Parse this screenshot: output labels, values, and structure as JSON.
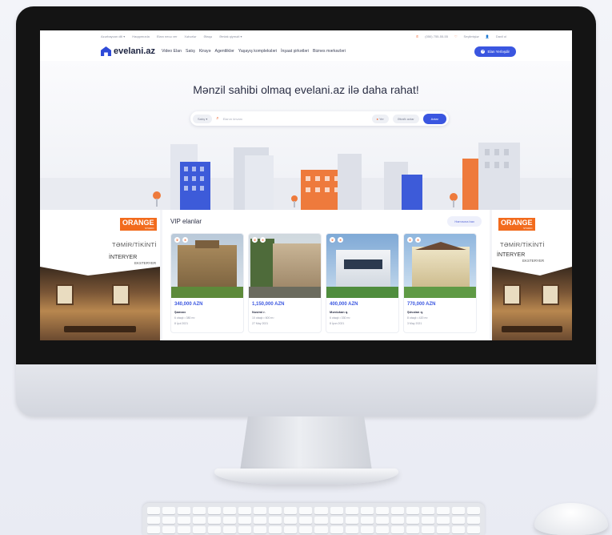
{
  "topbar": {
    "links": [
      "Azərbaycan dili ▾",
      "Haqqımızda",
      "Elanı necə ver",
      "Xəbərlər",
      "Əlaqə",
      "Əmlak qiyməti ▾"
    ],
    "phone": "(050) 755-55-55",
    "favorites": "Seçilmişlər",
    "login": "Daxil ol"
  },
  "navbar": {
    "logo_text": "evelani.az",
    "items": [
      "Video Elan",
      "Satış",
      "Kirayə",
      "Agentliklər",
      "Yaşayış kompleksləri",
      "İnşaat şirkətləri",
      "Biznes mərkəzləri"
    ],
    "post_button": "Elan Yerləşdir"
  },
  "hero": {
    "title": "Mənzil sahibi olmaq evelani.az ilə daha rahat!",
    "search": {
      "category": "Satış ▾",
      "placeholder": "Elanın ünvanı",
      "location": "Yer",
      "advanced": "Ətraflı axtar",
      "submit": "Axtar"
    }
  },
  "banners": {
    "brand": "ORANGE",
    "brand_sub": "STUDIO",
    "line1": "TƏMİR/TİKİNTİ",
    "line2": "İNTERYER",
    "line3": "EKSTERYER"
  },
  "vip": {
    "title": "VIP elanlar",
    "all_button": "Hamısına bax",
    "cards": [
      {
        "price": "340,000 AZN",
        "location": "Şamaxı",
        "meta": "6 otaqlı • 380 m²",
        "date": "8 İyul 2021"
      },
      {
        "price": "1,150,000 AZN",
        "location": "Nəsimi r.",
        "meta": "10 otaqlı • 600 m²",
        "date": "27 May 2021"
      },
      {
        "price": "400,000 AZN",
        "location": "Mərdəkan q.",
        "meta": "6 otaqlı • 330 m²",
        "date": "8 İyun 2021"
      },
      {
        "price": "770,000 AZN",
        "location": "Şüvəlan q.",
        "meta": "8 otaqlı • 420 m²",
        "date": "3 May 2021"
      }
    ]
  },
  "colors": {
    "accent": "#3a56e0",
    "orange": "#f26b3a",
    "bezel": "#141414"
  }
}
